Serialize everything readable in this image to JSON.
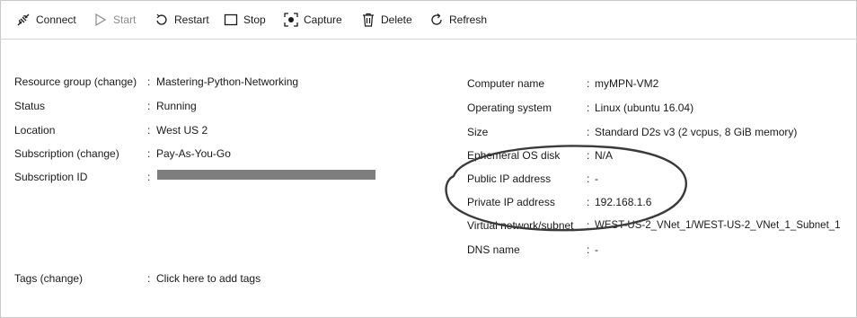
{
  "toolbar": {
    "items": [
      {
        "label": "Connect",
        "icon": "connect-icon"
      },
      {
        "label": "Start",
        "icon": "play-icon"
      },
      {
        "label": "Restart",
        "icon": "restart-icon"
      },
      {
        "label": "Stop",
        "icon": "stop-icon"
      },
      {
        "label": "Capture",
        "icon": "capture-icon"
      },
      {
        "label": "Delete",
        "icon": "trash-icon"
      },
      {
        "label": "Refresh",
        "icon": "refresh-icon"
      }
    ]
  },
  "left": [
    {
      "label": "Resource group (change)",
      "sep": ":",
      "value": "Mastering-Python-Networking"
    },
    {
      "label": "Status",
      "sep": ":",
      "value": "Running"
    },
    {
      "label": "Location",
      "sep": ":",
      "value": "West US 2"
    },
    {
      "label": "Subscription (change)",
      "sep": ":",
      "value": "Pay-As-You-Go"
    },
    {
      "label": "Subscription ID",
      "sep": ":",
      "value": ""
    },
    {
      "label": "Tags (change)",
      "sep": ":",
      "value": "Click here to add tags"
    }
  ],
  "right": [
    {
      "label": "Computer name",
      "sep": ":",
      "value": "myMPN-VM2"
    },
    {
      "label": "Operating system",
      "sep": ":",
      "value": "Linux (ubuntu 16.04)"
    },
    {
      "label": "Size",
      "sep": ":",
      "value": "Standard D2s v3 (2 vcpus, 8 GiB memory)"
    },
    {
      "label": "Ephemeral OS disk",
      "sep": ":",
      "value": "N/A"
    },
    {
      "label": "Public IP address",
      "sep": ":",
      "value": "-"
    },
    {
      "label": "Private IP address",
      "sep": ":",
      "value": "192.168.1.6"
    },
    {
      "label": "Virtual network/subnet",
      "sep": ":",
      "value": "WEST-US-2_VNet_1/WEST-US-2_VNet_1_Subnet_1"
    },
    {
      "label": "DNS name",
      "sep": ":",
      "value": "-"
    }
  ],
  "colors": {
    "text": "#1a1a1a",
    "disabled": "#8a8a8a",
    "redaction": "#7e7e7e",
    "annotation": "#3a3a3a"
  }
}
